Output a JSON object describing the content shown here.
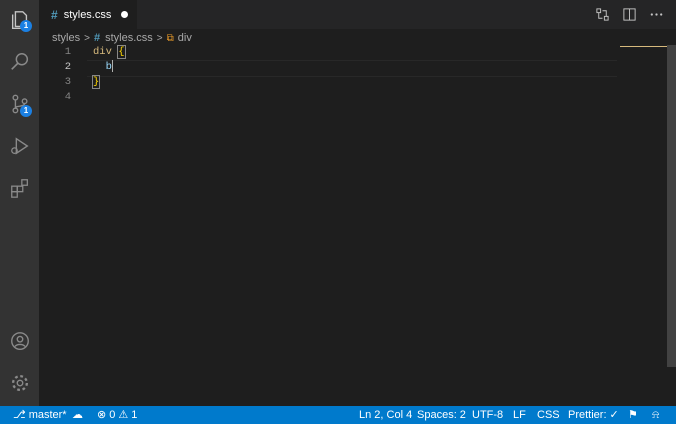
{
  "tab": {
    "icon": "#",
    "filename": "styles.css"
  },
  "breadcrumb": {
    "folder": "styles",
    "file_icon": "#",
    "file": "styles.css",
    "symbol": "div"
  },
  "activity": {
    "explorer_badge": "1",
    "scm_badge": "1"
  },
  "editor": {
    "line_numbers": [
      "1",
      "2",
      "3",
      "4"
    ],
    "line1_selector": "div",
    "line1_brace": "{",
    "line2_text": "b",
    "line3_brace": "}"
  },
  "status": {
    "branch": "master*",
    "errors": "0",
    "warnings": "1",
    "position": "Ln 2, Col 4",
    "spaces": "Spaces: 2",
    "encoding": "UTF-8",
    "eol": "LF",
    "language": "CSS",
    "prettier": "Prettier:"
  },
  "colors": {
    "accent": "#007acc",
    "activity_bg": "#333333",
    "editor_bg": "#1e1e1e",
    "badge": "#1b80e3"
  }
}
